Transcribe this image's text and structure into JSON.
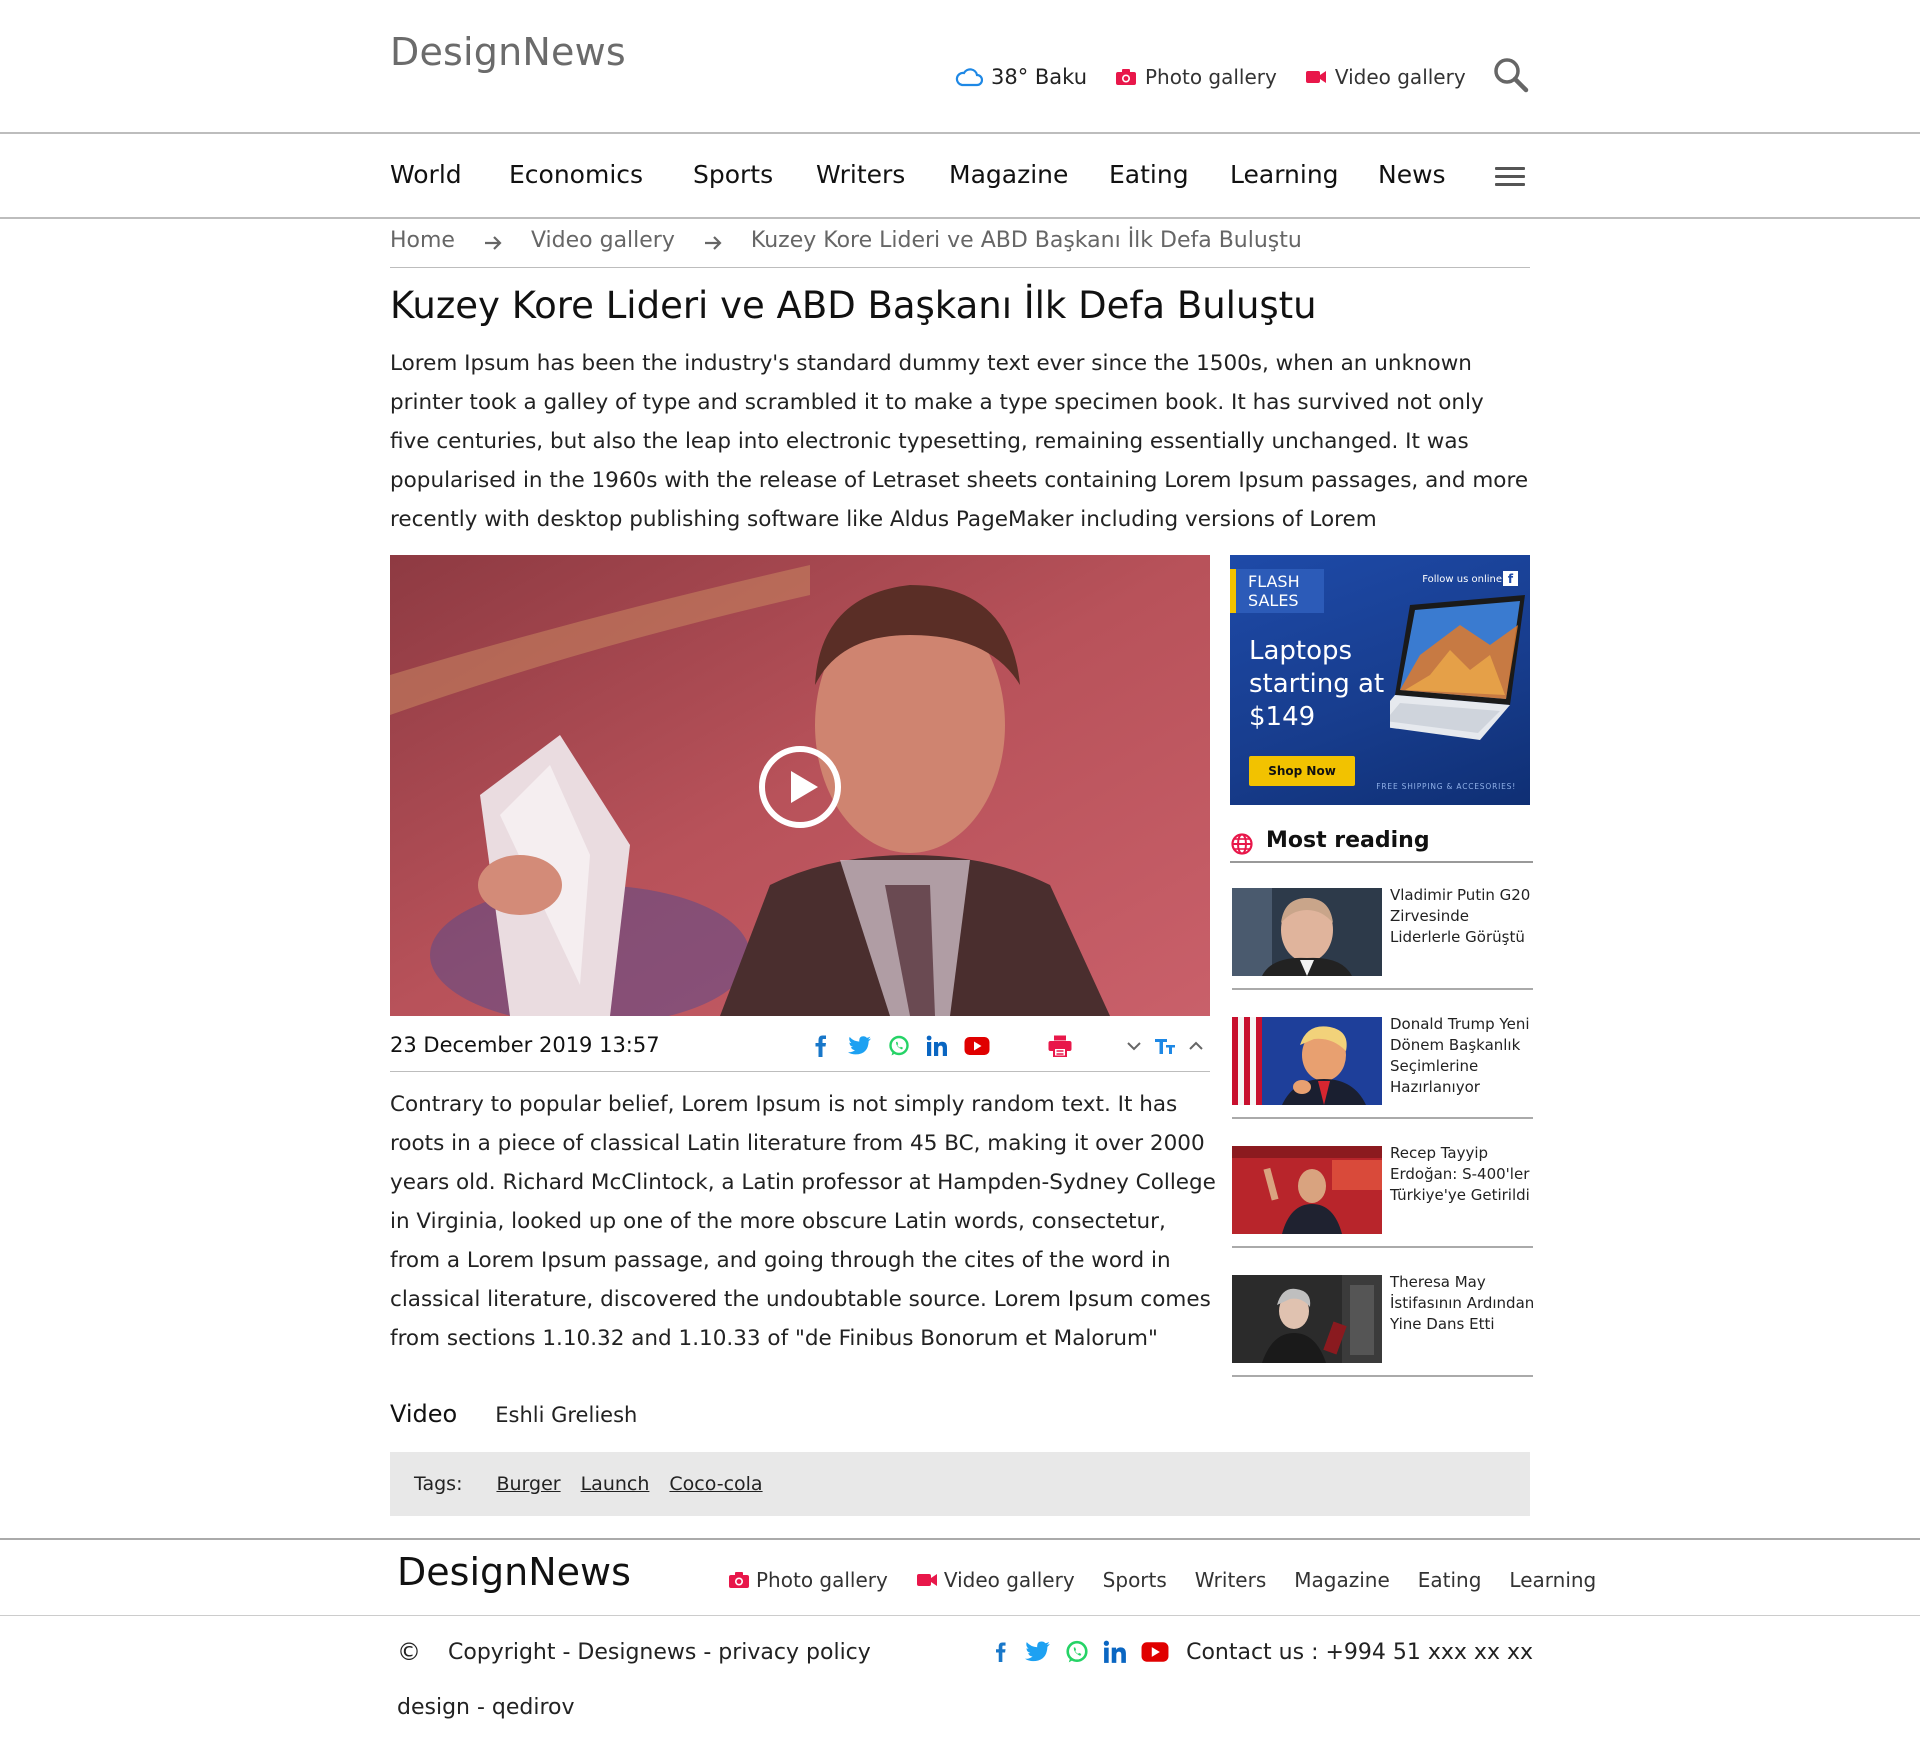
{
  "header": {
    "logo": "DesignNews",
    "weather": "38° Baku",
    "photo_gallery": "Photo gallery",
    "video_gallery": "Video gallery"
  },
  "nav": {
    "items": [
      "World",
      "Economics",
      "Sports",
      "Writers",
      "Magazine",
      "Eating",
      "Learning",
      "News"
    ]
  },
  "breadcrumb": {
    "home": "Home",
    "section": "Video gallery",
    "current": "Kuzey Kore Lideri ve ABD Başkanı İlk Defa Buluştu"
  },
  "article": {
    "title": "Kuzey Kore Lideri ve ABD Başkanı İlk Defa Buluştu",
    "lead": "Lorem Ipsum has been the industry's standard dummy text ever since the 1500s, when an unknown printer took a galley of type and scrambled it to make a type specimen book. It has survived not only five centuries, but also the leap into electronic typesetting, remaining essentially unchanged. It was popularised in the 1960s with the release of Letraset sheets containing Lorem Ipsum passages, and more recently with desktop publishing software like Aldus PageMaker including versions of Lorem",
    "date": "23 December 2019  13:57",
    "body": "Contrary to popular belief, Lorem Ipsum is not simply random text. It has roots in a piece of classical Latin literature from 45 BC, making it over 2000 years old. Richard McClintock, a Latin professor at Hampden-Sydney College in Virginia, looked up one of the more obscure Latin words, consectetur, from a Lorem Ipsum passage, and going through the cites of the word in classical literature, discovered the undoubtable source. Lorem Ipsum comes from sections 1.10.32 and 1.10.33 of \"de Finibus Bonorum et Malorum\"",
    "video_label": "Video",
    "video_author": "Eshli Greliesh",
    "tags_label": "Tags:",
    "tags": [
      "Burger",
      "Launch",
      "Coco-cola"
    ]
  },
  "ad": {
    "flash": "FLASH SALES",
    "follow": "Follow us online",
    "headline": "Laptops starting at $149",
    "button": "Shop Now",
    "shipping": "FREE SHIPPING & ACCESORIES!"
  },
  "sidebar": {
    "most_reading": "Most reading",
    "items": [
      "Vladimir Putin G20 Zirvesinde Liderlerle Görüştü",
      "Donald Trump Yeni Dönem Başkanlık Seçimlerine Hazırlanıyor",
      "Recep Tayyip Erdoğan: S-400'ler Türkiye'ye Getirildi",
      "Theresa May İstifasının Ardından Yine Dans Etti"
    ]
  },
  "footer": {
    "logo": "DesignNews",
    "nav": [
      "Photo gallery",
      "Video gallery",
      "Sports",
      "Writers",
      "Magazine",
      "Eating",
      "Learning"
    ],
    "copyright_symbol": "©",
    "copyright": "Copyright - Designews - privacy policy",
    "contact": "Contact us : +994 51 xxx xx xx",
    "design": "design - qedirov"
  },
  "colors": {
    "accent_red": "#e8174a",
    "facebook": "#1877c9",
    "twitter": "#1da1f2",
    "whatsapp": "#25d366",
    "linkedin": "#0a66c2",
    "youtube": "#e00000"
  }
}
